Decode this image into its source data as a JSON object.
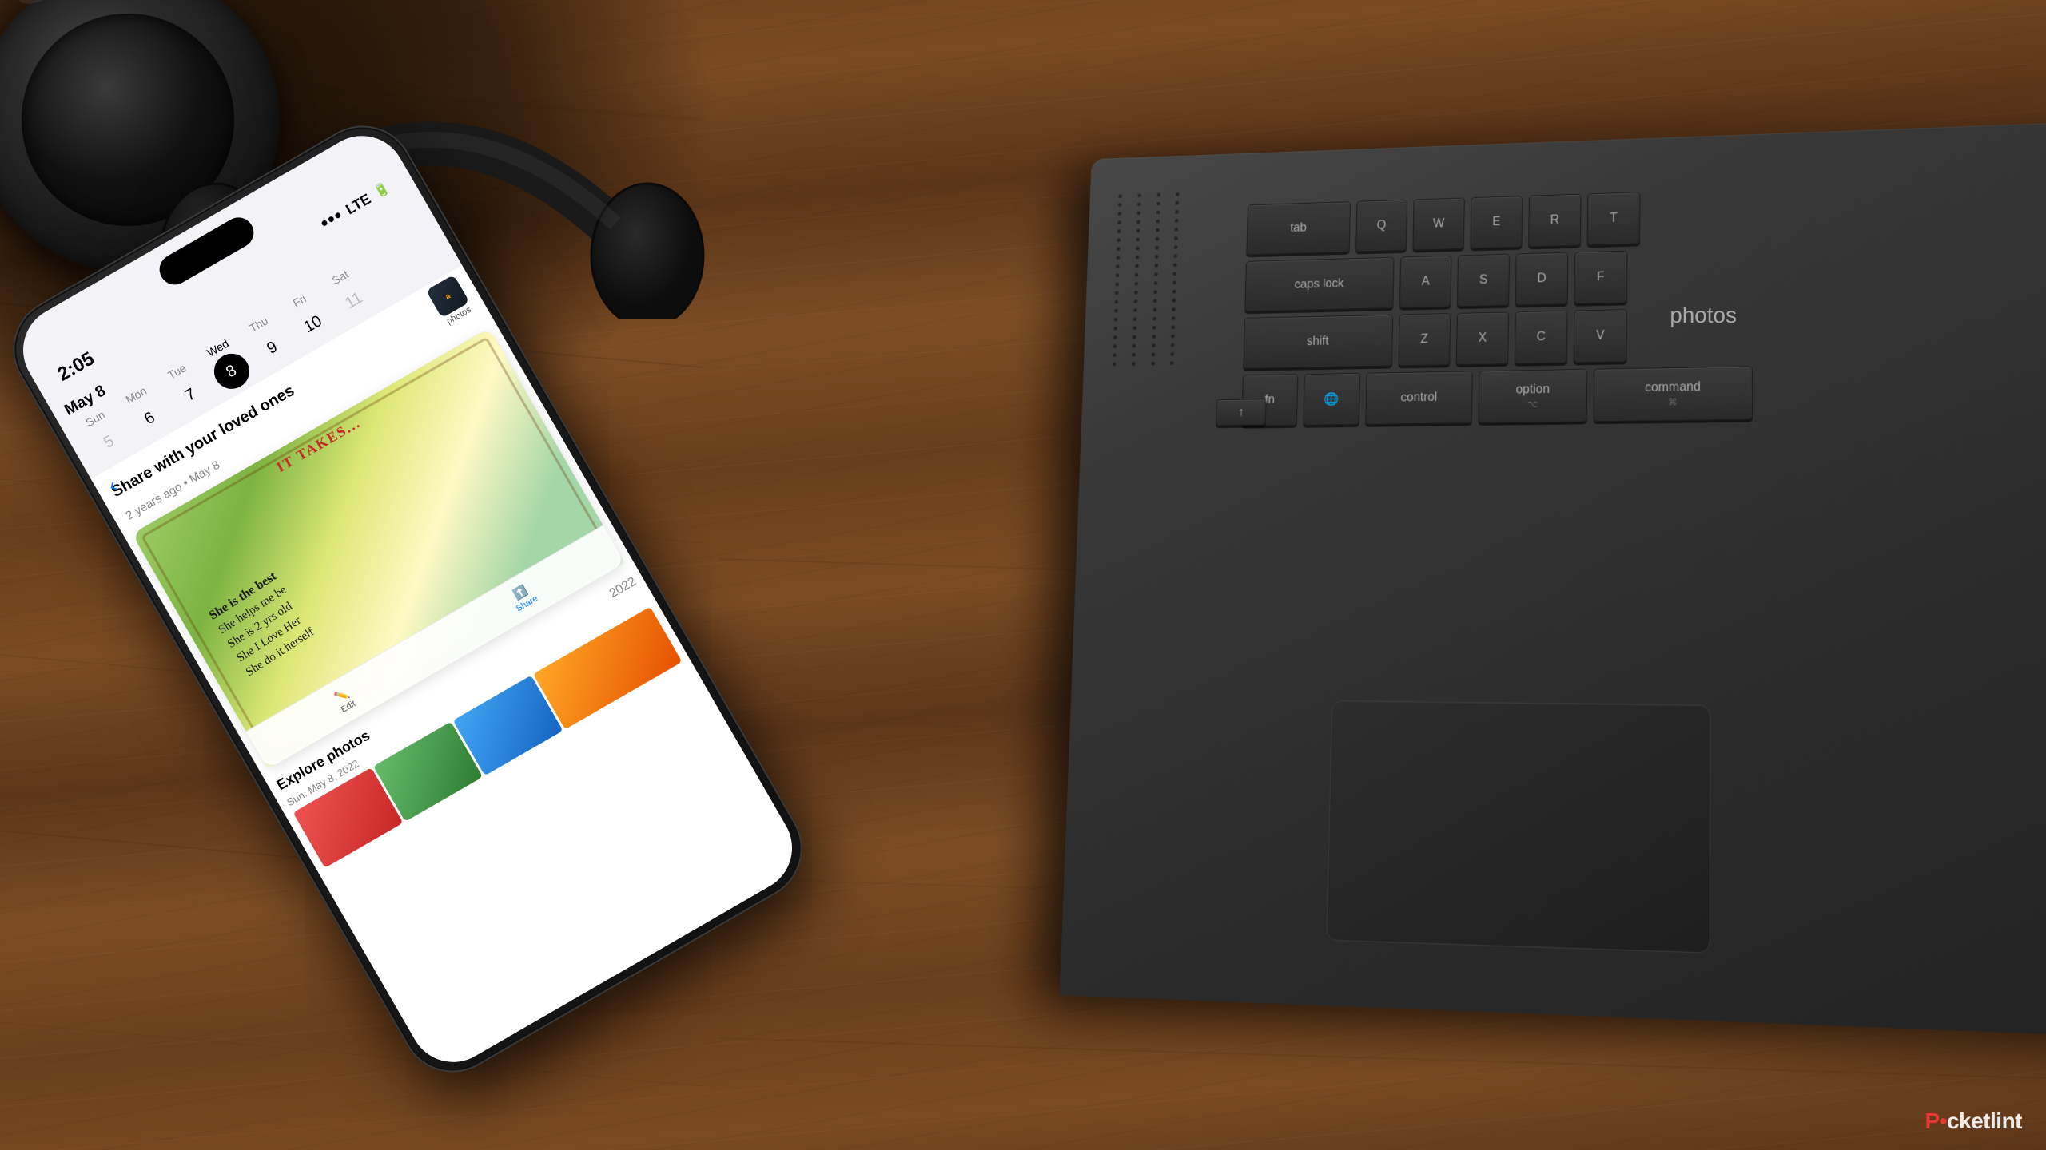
{
  "scene": {
    "background_color": "#5a3a1a",
    "description": "Wood table with iPhone, camera, headphones and laptop"
  },
  "iphone": {
    "status": {
      "time": "2:05",
      "signal": "LTE",
      "battery": "77"
    },
    "calendar": {
      "month": "May 8",
      "days": [
        {
          "name": "Sun",
          "num": "5",
          "active": false
        },
        {
          "name": "Mon",
          "num": "6",
          "active": false
        },
        {
          "name": "Tue",
          "num": "7",
          "active": false
        },
        {
          "name": "Wed",
          "num": "8",
          "active": true
        },
        {
          "name": "Thu",
          "num": "9",
          "active": false
        },
        {
          "name": "Fri",
          "num": "10",
          "active": false
        },
        {
          "name": "Sat",
          "num": "11",
          "active": false
        }
      ]
    },
    "photos_app": {
      "share_heading": "Share with your loved ones",
      "share_subtext": "2 years ago • May 8",
      "photo_label": "photos",
      "photo_amazon": "amazon",
      "handwritten_text": [
        "She is the best",
        "She helps me",
        "She is 2 yrs",
        "She I love Her",
        "She do it herself"
      ],
      "edit_label": "Edit",
      "share_label": "Share",
      "explore_label": "Explore photos",
      "year_label": "2022",
      "date_label": "Sun. May 8, 2022"
    }
  },
  "laptop": {
    "keyboard": {
      "rows": [
        [
          "tab",
          "Q",
          "W",
          "E",
          "R",
          "T"
        ],
        [
          "caps lock",
          "A",
          "S",
          "D",
          "F"
        ],
        [
          "shift",
          "Z",
          "X",
          "C",
          "V"
        ],
        [
          "fn",
          "↑",
          "⌥",
          "⌘",
          "control",
          "option",
          "command"
        ]
      ]
    }
  },
  "watermark": {
    "brand": "Pocketlint",
    "brand_display": "P●cketlint"
  }
}
